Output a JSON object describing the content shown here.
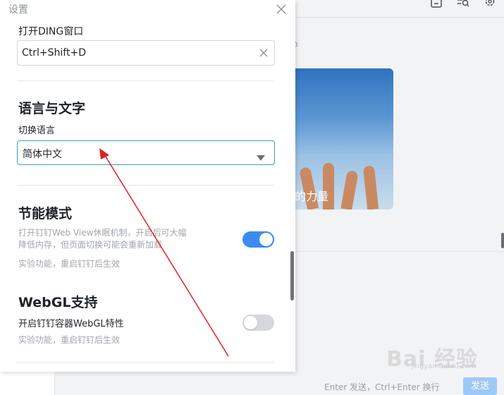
{
  "background": {
    "toolbar_icons": [
      "minimize-icon",
      "search-list-icon",
      "settings-gear-icon"
    ],
    "partial_text_top": "D",
    "card_caption": "的力量",
    "compose_hint": "Enter 发送，Ctrl+Enter 换行",
    "send_button": "发送"
  },
  "watermark": {
    "text": "Bai 经验",
    "subtext": "jingyan.baidu.com"
  },
  "settings": {
    "title": "设置",
    "hotkey": {
      "label": "打开DING窗口",
      "value": "Ctrl+Shift+D"
    },
    "language": {
      "section_title": "语言与文字",
      "label": "切换语言",
      "selected": "简体中文"
    },
    "energy": {
      "section_title": "节能模式",
      "description": "打开钉钉Web View休眠机制，开启后可大幅降低内存，但页面切换可能会重新加载",
      "note": "实验功能，重启钉钉后生效",
      "enabled": true
    },
    "webgl": {
      "section_title": "WebGL支持",
      "label": "开启钉钉容器WebGL特性",
      "note": "实验功能，重启钉钉后生效",
      "enabled": false
    }
  },
  "colors": {
    "accent": "#3c8cf0",
    "select_border": "#3d9fb6",
    "arrow": "#e02020"
  }
}
